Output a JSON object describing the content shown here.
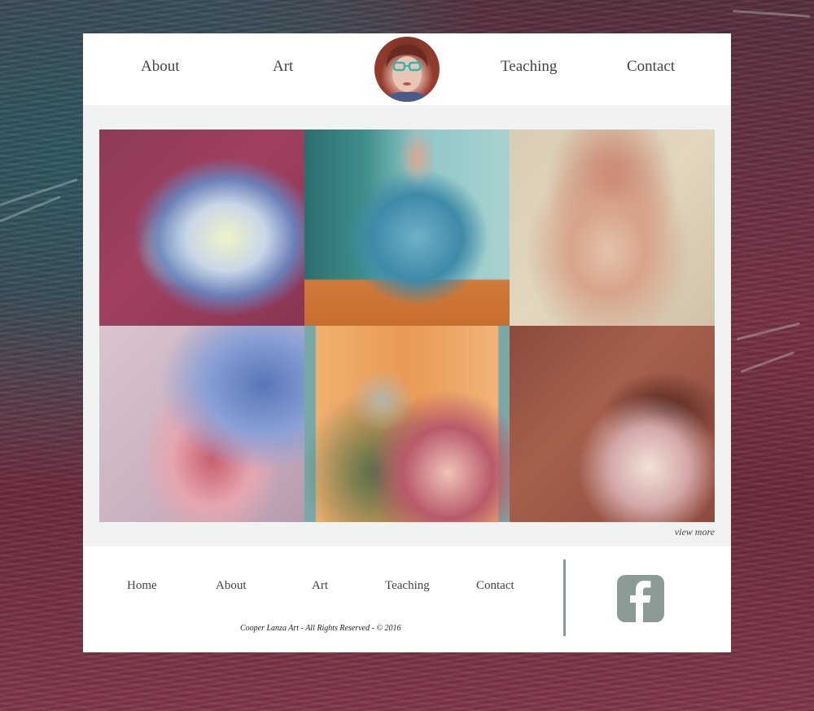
{
  "header": {
    "nav": [
      {
        "label": "About"
      },
      {
        "label": "Art"
      },
      {
        "label": "Teaching"
      },
      {
        "label": "Contact"
      }
    ],
    "avatar_icon": "artist-portrait-avatar"
  },
  "gallery": {
    "tiles": [
      {
        "subject": "painting of clasped hands"
      },
      {
        "subject": "woman in blue sweater painting"
      },
      {
        "subject": "red chalk face study"
      },
      {
        "subject": "portrait of woman in headwrap"
      },
      {
        "subject": "mother and child in winter hats"
      },
      {
        "subject": "portrait of dark-haired woman"
      }
    ],
    "view_more": "view more"
  },
  "footer": {
    "nav": [
      {
        "label": "Home"
      },
      {
        "label": "About"
      },
      {
        "label": "Art"
      },
      {
        "label": "Teaching"
      },
      {
        "label": "Contact"
      }
    ],
    "copyright": "Cooper Lanza Art - All Rights Reserved - © 2016",
    "social_icon": "facebook-icon"
  },
  "colors": {
    "panel": "#ffffff",
    "content_bg": "#f1f2f2",
    "text": "#444444",
    "facebook": "#8b9a95"
  }
}
